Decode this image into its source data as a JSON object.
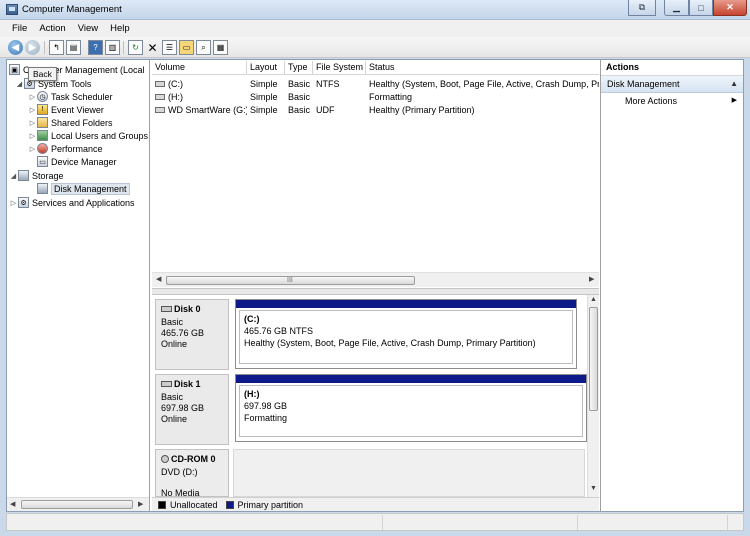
{
  "window": {
    "title": "Computer Management"
  },
  "menu": [
    "File",
    "Action",
    "View",
    "Help"
  ],
  "toolbar": {
    "back_tooltip": "Back",
    "icons": [
      "back-icon",
      "forward-icon",
      "up-folder-icon",
      "show-hide-tree-icon",
      "help-icon",
      "show-hide-action-pane-icon",
      "refresh-icon",
      "delete-icon",
      "properties-icon",
      "open-icon",
      "search-icon",
      "disk-view-icon"
    ]
  },
  "tree": {
    "root": "Computer Management (Local",
    "items": [
      {
        "label": "System Tools",
        "level": 1,
        "expand": "collapse"
      },
      {
        "label": "Task Scheduler",
        "level": 2,
        "expand": "expand",
        "icon": "clock-icon"
      },
      {
        "label": "Event Viewer",
        "level": 2,
        "expand": "expand",
        "icon": "event-viewer-icon"
      },
      {
        "label": "Shared Folders",
        "level": 2,
        "expand": "expand",
        "icon": "shared-folder-icon"
      },
      {
        "label": "Local Users and Groups",
        "level": 2,
        "expand": "expand",
        "icon": "users-icon"
      },
      {
        "label": "Performance",
        "level": 2,
        "expand": "expand",
        "icon": "performance-icon"
      },
      {
        "label": "Device Manager",
        "level": 2,
        "expand": "",
        "icon": "device-manager-icon"
      },
      {
        "label": "Storage",
        "level": 1,
        "expand": "collapse",
        "icon": "storage-icon"
      },
      {
        "label": "Disk Management",
        "level": 2,
        "expand": "",
        "icon": "disk-management-icon",
        "selected": true
      },
      {
        "label": "Services and Applications",
        "level": 1,
        "expand": "expand",
        "icon": "services-icon"
      }
    ]
  },
  "volumes": {
    "columns": [
      "Volume",
      "Layout",
      "Type",
      "File System",
      "Status"
    ],
    "rows": [
      [
        "(C:)",
        "Simple",
        "Basic",
        "NTFS",
        "Healthy (System, Boot, Page File, Active, Crash Dump, Pri"
      ],
      [
        "(H:)",
        "Simple",
        "Basic",
        "",
        "Formatting"
      ],
      [
        "WD SmartWare (G:)",
        "Simple",
        "Basic",
        "UDF",
        "Healthy (Primary Partition)"
      ]
    ],
    "scroll_grip": "III"
  },
  "disks": [
    {
      "name": "Disk 0",
      "type": "Basic",
      "size": "465.76 GB",
      "state": "Online",
      "partition": {
        "name": "(C:)",
        "detail": "465.76 GB NTFS",
        "status": "Healthy (System, Boot, Page File, Active, Crash Dump, Primary Partition)"
      }
    },
    {
      "name": "Disk 1",
      "type": "Basic",
      "size": "697.98 GB",
      "state": "Online",
      "partition": {
        "name": "(H:)",
        "detail": "697.98 GB",
        "status": "Formatting"
      }
    },
    {
      "name": "CD-ROM 0",
      "type": "DVD (D:)",
      "media": "No Media"
    }
  ],
  "legend": [
    {
      "label": "Unallocated",
      "color": "#000000"
    },
    {
      "label": "Primary partition",
      "color": "#0e1a8a"
    }
  ],
  "actions": {
    "header": "Actions",
    "section": "Disk Management",
    "items": [
      "More Actions"
    ]
  }
}
